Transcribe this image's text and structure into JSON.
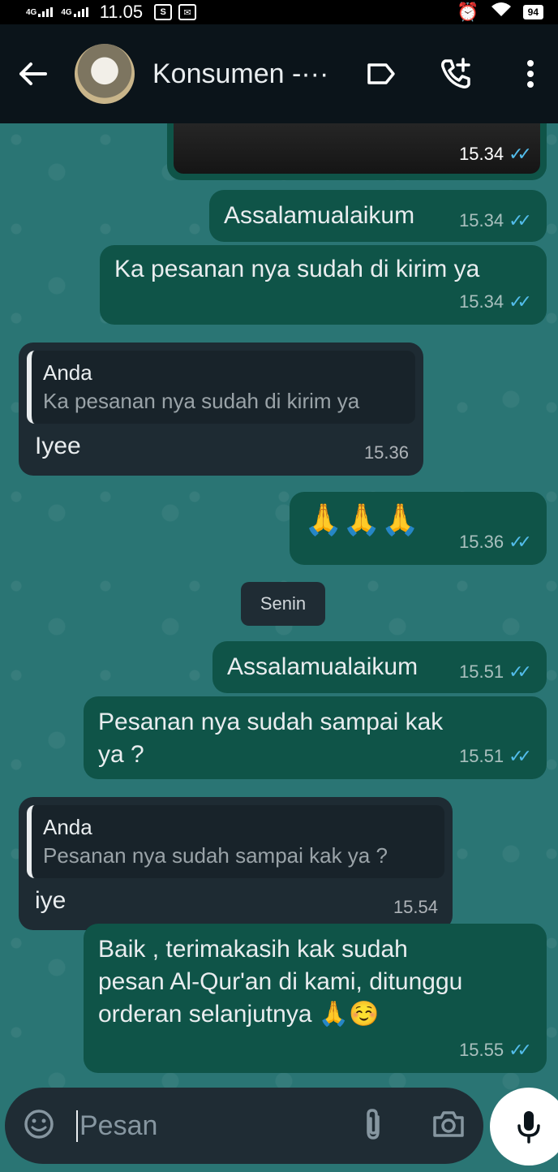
{
  "status_bar": {
    "network1": "4G",
    "network2": "4G",
    "time": "11.05",
    "battery": "94"
  },
  "header": {
    "contact_name": "Konsumen -···"
  },
  "messages": [
    {
      "type": "out",
      "meta_time": "15.34",
      "is_image_tail": true
    },
    {
      "type": "out",
      "text": "Assalamualaikum",
      "time": "15.34"
    },
    {
      "type": "out",
      "text": "Ka pesanan nya sudah di kirim ya",
      "time": "15.34"
    },
    {
      "type": "in",
      "quote_author": "Anda",
      "quote_text": "Ka pesanan nya sudah di kirim ya",
      "text": "Iyee",
      "time": "15.36"
    },
    {
      "type": "out",
      "text": "🙏🙏🙏",
      "time": "15.36"
    },
    {
      "type": "date",
      "text": "Senin"
    },
    {
      "type": "out",
      "text": "Assalamualaikum",
      "time": "15.51"
    },
    {
      "type": "out",
      "text_line1": "Pesanan nya sudah sampai kak",
      "text_line2": "ya ?",
      "time": "15.51"
    },
    {
      "type": "in",
      "quote_author": "Anda",
      "quote_text": "Pesanan nya sudah sampai kak ya ?",
      "text": "iye",
      "time": "15.54"
    },
    {
      "type": "out",
      "text_line1": "Baik , terimakasih kak sudah",
      "text_line2": "pesan Al-Qur'an di kami, ditunggu",
      "text_line3": "orderan selanjutnya 🙏☺️",
      "time": "15.55"
    }
  ],
  "composer": {
    "placeholder": "Pesan"
  },
  "colors": {
    "chat_bg": "#2a7574",
    "outgoing_bubble": "#0f5448",
    "incoming_bubble": "#1e2b33",
    "read_ticks": "#53bdeb"
  }
}
